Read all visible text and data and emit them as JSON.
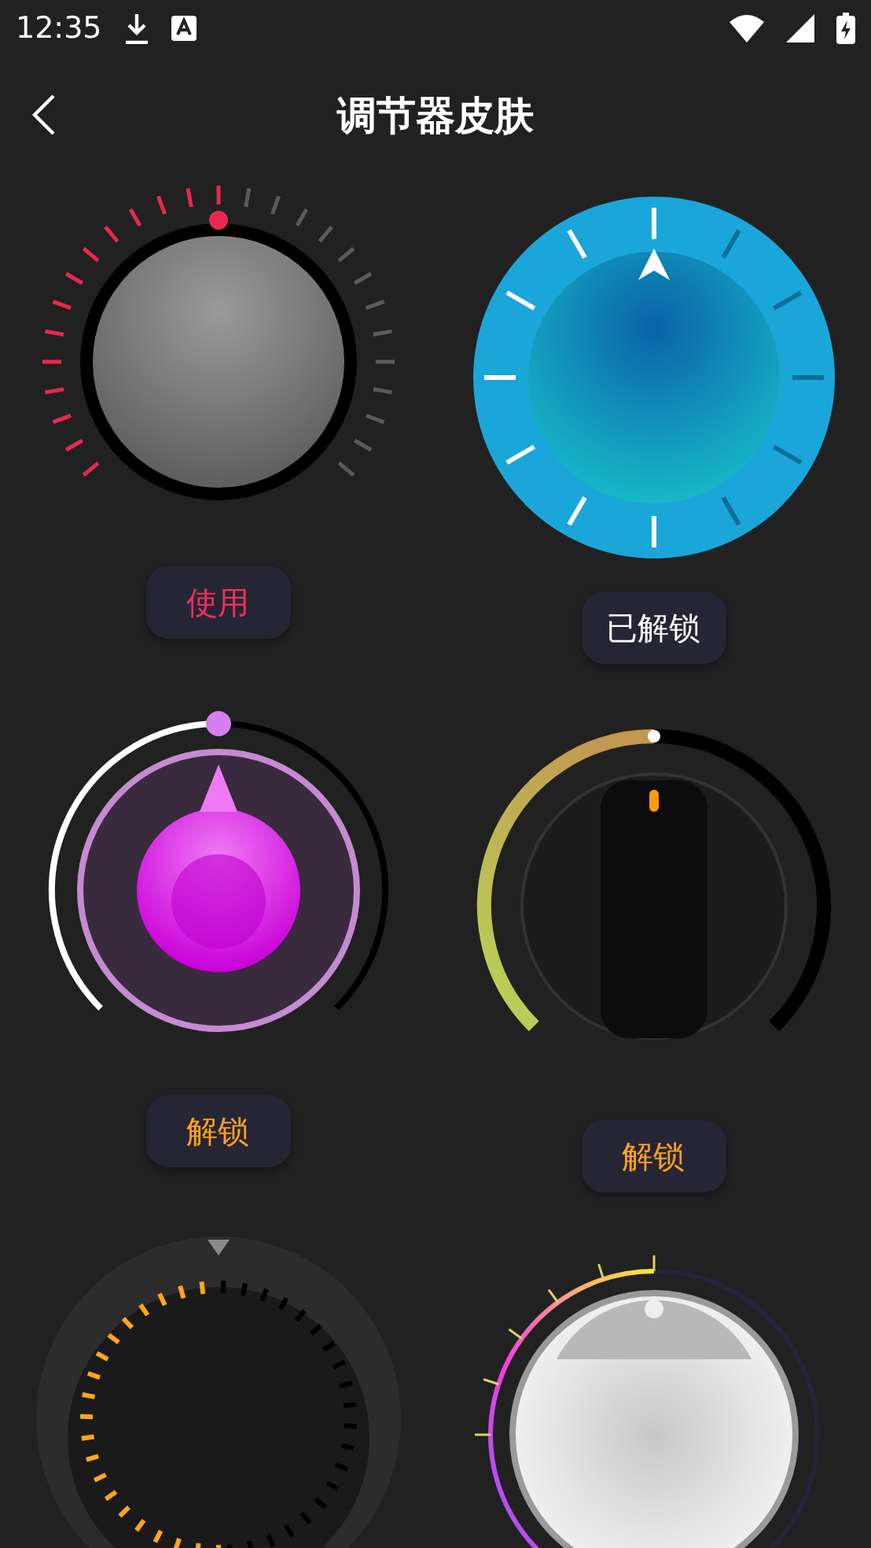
{
  "status_bar": {
    "time": "12:35"
  },
  "header": {
    "title": "调节器皮肤"
  },
  "skins": [
    {
      "kind": "ticks",
      "button": {
        "label": "使用",
        "kind": "use"
      }
    },
    {
      "kind": "blue",
      "button": {
        "label": "已解锁",
        "kind": "unlocked"
      }
    },
    {
      "kind": "magenta",
      "button": {
        "label": "解锁",
        "kind": "unlock"
      }
    },
    {
      "kind": "grip",
      "button": {
        "label": "解锁",
        "kind": "unlock"
      }
    },
    {
      "kind": "dark"
    },
    {
      "kind": "silver"
    }
  ]
}
